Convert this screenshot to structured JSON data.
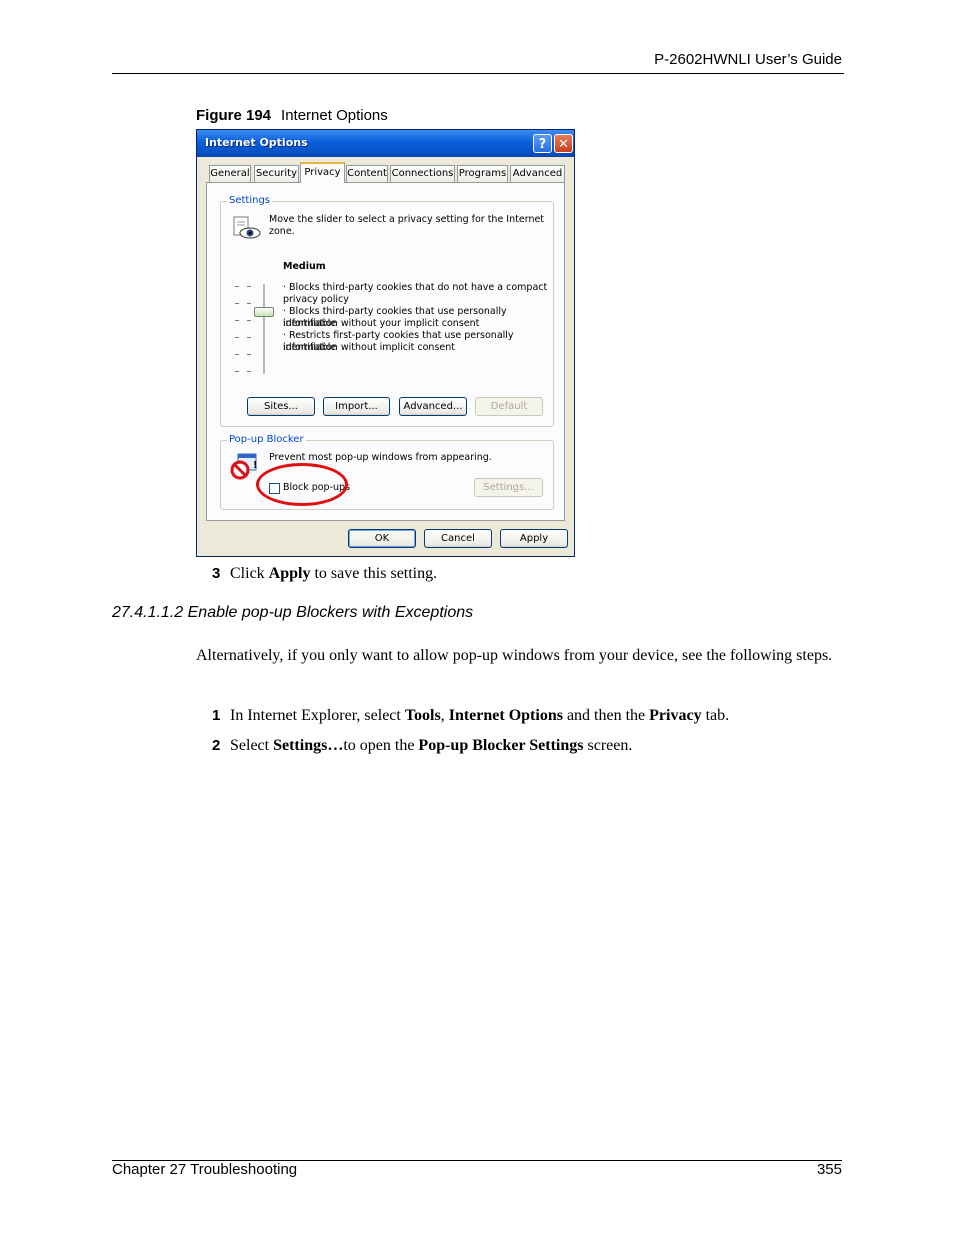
{
  "header": {
    "guide_title": "P-2602HWNLI User’s Guide"
  },
  "figure": {
    "number": "Figure 194",
    "title": "Internet Options"
  },
  "dialog": {
    "title": "Internet Options",
    "help_glyph": "?",
    "close_glyph": "✕",
    "tabs": [
      "General",
      "Security",
      "Privacy",
      "Content",
      "Connections",
      "Programs",
      "Advanced"
    ],
    "active_tab": "Privacy",
    "settings": {
      "group_label": "Settings",
      "intro": [
        "Move the slider to select a privacy setting for the Internet",
        "zone."
      ],
      "level_title": "Medium",
      "level_desc": [
        "· Blocks third-party cookies that do not have a compact",
        "privacy policy",
        "· Blocks third-party cookies that use personally identifiable",
        "information without your implicit consent",
        "· Restricts first-party cookies that use personally identifiable",
        "information without implicit consent"
      ],
      "buttons": {
        "sites": "Sites...",
        "import": "Import...",
        "advanced": "Advanced...",
        "default": "Default"
      }
    },
    "popup_blocker": {
      "group_label": "Pop-up Blocker",
      "description": "Prevent most pop-up windows from appearing.",
      "checkbox_label": "Block pop-ups",
      "checkbox_checked": false,
      "settings_button": "Settings..."
    },
    "footer_buttons": {
      "ok": "OK",
      "cancel": "Cancel",
      "apply": "Apply"
    },
    "icons": [
      "cookie-eye-icon",
      "popup-blocked-icon"
    ],
    "highlight_color": "#e01010"
  },
  "body": {
    "step3": {
      "num": "3",
      "pre": "Click ",
      "bold": "Apply",
      "post": " to save this setting."
    },
    "subheading": "27.4.1.1.2  Enable pop-up Blockers with Exceptions",
    "paragraph": "Alternatively, if you only want to allow pop-up windows from your device, see the following steps.",
    "step1": {
      "num": "1",
      "t1": "In Internet Explorer, select ",
      "b1": "Tools",
      "t2": ", ",
      "b2": "Internet Options",
      "t3": " and then the ",
      "b3": "Privacy",
      "t4": " tab."
    },
    "step2": {
      "num": "2",
      "t1": "Select ",
      "b1": "Settings…",
      "t2": "to open the ",
      "b2": "Pop-up Blocker Settings",
      "t3": " screen."
    }
  },
  "footer": {
    "chapter": "Chapter 27 Troubleshooting",
    "page_number": "355"
  }
}
